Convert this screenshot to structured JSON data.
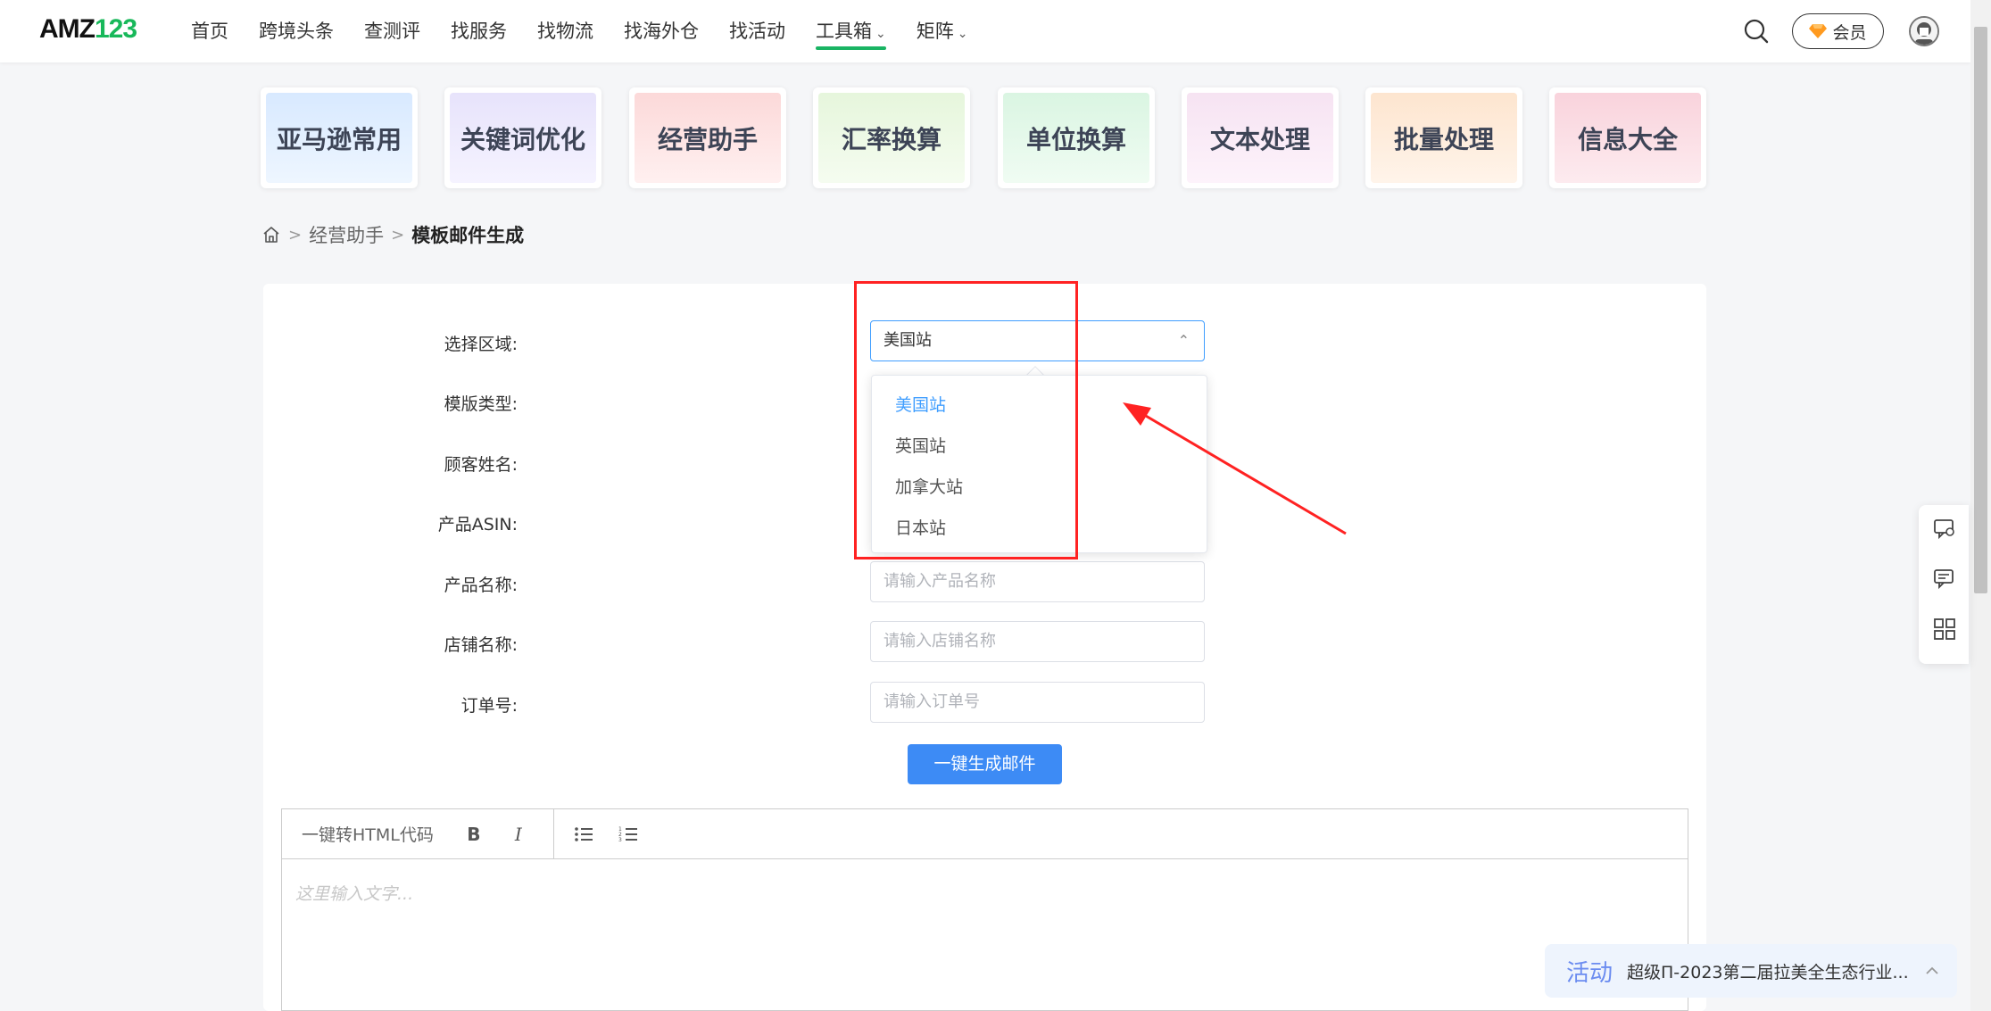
{
  "header": {
    "logo_main": "AMZ",
    "logo_num": "123",
    "nav": [
      {
        "label": "首页"
      },
      {
        "label": "跨境头条"
      },
      {
        "label": "查测评"
      },
      {
        "label": "找服务"
      },
      {
        "label": "找物流"
      },
      {
        "label": "找海外仓"
      },
      {
        "label": "找活动"
      },
      {
        "label": "工具箱",
        "dropdown": true,
        "active": true
      },
      {
        "label": "矩阵",
        "dropdown": true
      }
    ],
    "vip_label": "会员",
    "icons": {
      "search": "search-icon",
      "vip": "diamond-icon",
      "avatar": "avatar"
    }
  },
  "categories": [
    {
      "label": "亚马逊常用",
      "bg": "#e3efff"
    },
    {
      "label": "关键词优化",
      "bg": "#eeeafc"
    },
    {
      "label": "经营助手",
      "bg": "#fde4e4"
    },
    {
      "label": "汇率换算",
      "bg": "#eef9e8"
    },
    {
      "label": "单位换算",
      "bg": "#e4f8ea"
    },
    {
      "label": "文本处理",
      "bg": "#f9ecf6"
    },
    {
      "label": "批量处理",
      "bg": "#fdeede"
    },
    {
      "label": "信息大全",
      "bg": "#fbe0e6"
    }
  ],
  "breadcrumb": {
    "parent": "经营助手",
    "current": "模板邮件生成"
  },
  "form": {
    "region_label": "选择区域:",
    "region_value": "美国站",
    "template_label": "模版类型:",
    "customer_label": "顾客姓名:",
    "asin_label": "产品ASIN:",
    "product_label": "产品名称:",
    "product_placeholder": "请输入产品名称",
    "store_label": "店铺名称:",
    "store_placeholder": "请输入店铺名称",
    "order_label": "订单号:",
    "order_placeholder": "请输入订单号",
    "generate_button": "一键生成邮件"
  },
  "region_dropdown": {
    "options": [
      "美国站",
      "英国站",
      "加拿大站",
      "日本站"
    ],
    "selected": "美国站"
  },
  "editor": {
    "html_button": "一键转HTML代码",
    "bold": "B",
    "italic": "I",
    "placeholder": "这里输入文字..."
  },
  "activity": {
    "tag": "活动",
    "text": "超级П-2023第二届拉美全生态行业..."
  },
  "colors": {
    "brand_green": "#19b463",
    "primary_blue": "#409eff",
    "annotation_red": "#ff2222"
  }
}
